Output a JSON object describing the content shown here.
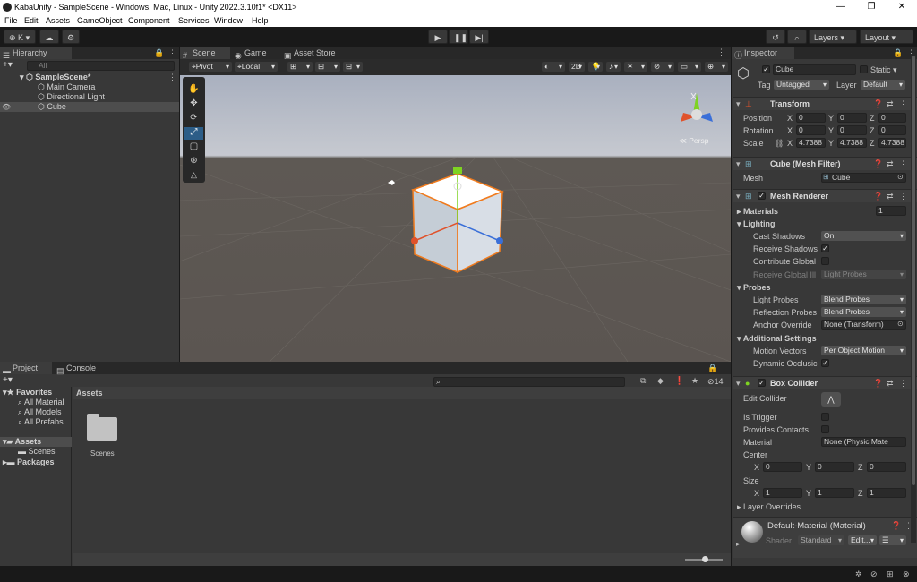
{
  "window": {
    "title": "KabaUnity - SampleScene - Windows, Mac, Linux - Unity 2022.3.10f1* <DX11>",
    "minimize": "—",
    "maximize": "❐",
    "close": "✕"
  },
  "menu": [
    "File",
    "Edit",
    "Assets",
    "GameObject",
    "Component",
    "Services",
    "Window",
    "Help"
  ],
  "toolbar": {
    "account": "K",
    "layers": "Layers",
    "layout": "Layout"
  },
  "hierarchy": {
    "tab": "Hierarchy",
    "search_placeholder": "All",
    "scene": "SampleScene*",
    "items": [
      "Main Camera",
      "Directional Light",
      "Cube"
    ]
  },
  "scene_view": {
    "tabs": [
      "Scene",
      "Game",
      "Asset Store"
    ],
    "pivot": "Pivot",
    "local": "Local",
    "mode_2d": "2D",
    "persp": "Persp"
  },
  "project": {
    "tabs": [
      "Project",
      "Console"
    ],
    "favorites": "Favorites",
    "favorite_items": [
      "All Material",
      "All Models",
      "All Prefabs"
    ],
    "assets": "Assets",
    "asset_children": [
      "Scenes"
    ],
    "packages": "Packages",
    "breadcrumb": "Assets",
    "folder": "Scenes",
    "count": "14"
  },
  "inspector": {
    "tab": "Inspector",
    "object_name": "Cube",
    "static": "Static",
    "tag_label": "Tag",
    "tag": "Untagged",
    "layer_label": "Layer",
    "layer": "Default",
    "transform": {
      "title": "Transform",
      "position_label": "Position",
      "position": [
        "0",
        "0",
        "0"
      ],
      "rotation_label": "Rotation",
      "rotation": [
        "0",
        "0",
        "0"
      ],
      "scale_label": "Scale",
      "scale": [
        "4.7388",
        "4.7388",
        "4.7388"
      ],
      "axes": [
        "X",
        "Y",
        "Z"
      ]
    },
    "mesh_filter": {
      "title": "Cube (Mesh Filter)",
      "mesh_label": "Mesh",
      "mesh": "Cube"
    },
    "mesh_renderer": {
      "title": "Mesh Renderer",
      "materials_label": "Materials",
      "materials_count": "1",
      "lighting": "Lighting",
      "cast_shadows_label": "Cast Shadows",
      "cast_shadows": "On",
      "receive_shadows_label": "Receive Shadows",
      "contribute_global_label": "Contribute Global",
      "receive_gi_label": "Receive Global Ill",
      "receive_gi": "Light Probes",
      "probes": "Probes",
      "light_probes_label": "Light Probes",
      "light_probes": "Blend Probes",
      "reflection_probes_label": "Reflection Probes",
      "reflection_probes": "Blend Probes",
      "anchor_override_label": "Anchor Override",
      "anchor_override": "None (Transform)",
      "additional": "Additional Settings",
      "motion_vectors_label": "Motion Vectors",
      "motion_vectors": "Per Object Motion",
      "dynamic_occlusion_label": "Dynamic Occlusic"
    },
    "box_collider": {
      "title": "Box Collider",
      "edit_collider_label": "Edit Collider",
      "is_trigger_label": "Is Trigger",
      "provides_contacts_label": "Provides Contacts",
      "material_label": "Material",
      "material": "None (Physic Mate",
      "center_label": "Center",
      "center": [
        "0",
        "0",
        "0"
      ],
      "size_label": "Size",
      "size": [
        "1",
        "1",
        "1"
      ],
      "layer_overrides": "Layer Overrides"
    },
    "material": {
      "title": "Default-Material (Material)",
      "shader_label": "Shader",
      "shader": "Standard",
      "edit": "Edit..."
    }
  },
  "colors": {
    "accent": "#2c5d87",
    "selection": "#2c5d87",
    "cube_outline": "#f07b1e"
  }
}
